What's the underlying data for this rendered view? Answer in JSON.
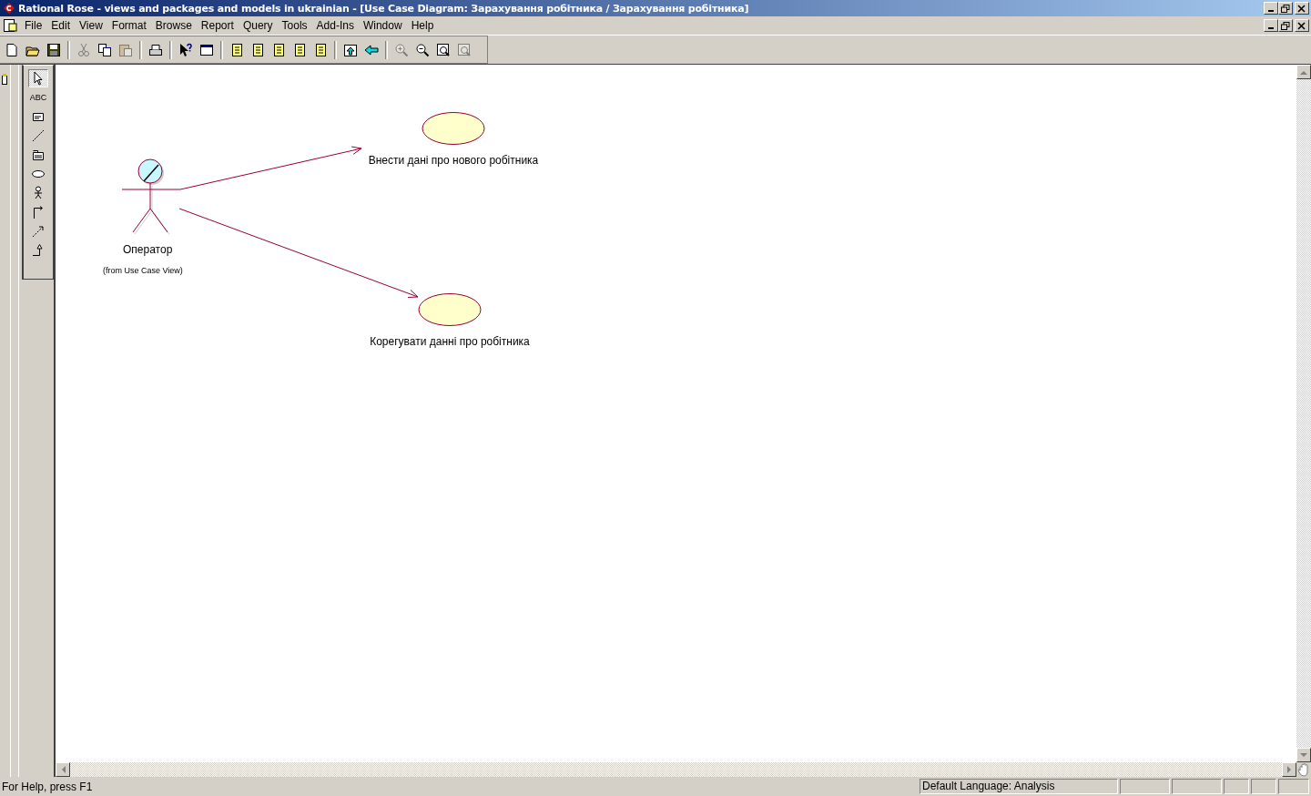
{
  "window": {
    "title": "Rational Rose - views and packages and models in ukrainian - [Use Case Diagram: Зарахування робітника / Зарахування робітника]"
  },
  "menu": [
    {
      "label": "File"
    },
    {
      "label": "Edit"
    },
    {
      "label": "View"
    },
    {
      "label": "Format"
    },
    {
      "label": "Browse"
    },
    {
      "label": "Report"
    },
    {
      "label": "Query"
    },
    {
      "label": "Tools"
    },
    {
      "label": "Add-Ins"
    },
    {
      "label": "Window"
    },
    {
      "label": "Help"
    }
  ],
  "toolbar": [
    {
      "kind": "new",
      "disabled": false
    },
    {
      "kind": "open",
      "disabled": false
    },
    {
      "kind": "save",
      "disabled": false
    },
    {
      "kind": "sep"
    },
    {
      "kind": "cut",
      "disabled": true
    },
    {
      "kind": "copy",
      "disabled": false
    },
    {
      "kind": "paste",
      "disabled": true
    },
    {
      "kind": "sep"
    },
    {
      "kind": "print",
      "disabled": false
    },
    {
      "kind": "sep"
    },
    {
      "kind": "helpcursor",
      "disabled": false
    },
    {
      "kind": "window",
      "disabled": false
    },
    {
      "kind": "sep"
    },
    {
      "kind": "doc",
      "disabled": false
    },
    {
      "kind": "doc",
      "disabled": false
    },
    {
      "kind": "doc",
      "disabled": false
    },
    {
      "kind": "doc",
      "disabled": false
    },
    {
      "kind": "doc",
      "disabled": false
    },
    {
      "kind": "sep"
    },
    {
      "kind": "up",
      "disabled": false
    },
    {
      "kind": "back",
      "disabled": false
    },
    {
      "kind": "sep"
    },
    {
      "kind": "zoomin",
      "disabled": true
    },
    {
      "kind": "zoomout",
      "disabled": false
    },
    {
      "kind": "fit",
      "disabled": false
    },
    {
      "kind": "fit",
      "disabled": true
    }
  ],
  "toolbox": [
    {
      "kind": "pointer",
      "selected": true
    },
    {
      "kind": "text",
      "label": "ABC",
      "selected": false
    },
    {
      "kind": "note",
      "selected": false
    },
    {
      "kind": "anchor",
      "selected": false
    },
    {
      "kind": "package",
      "selected": false
    },
    {
      "kind": "usecase",
      "selected": false
    },
    {
      "kind": "actor",
      "selected": false
    },
    {
      "kind": "association",
      "selected": false
    },
    {
      "kind": "dependency",
      "selected": false
    },
    {
      "kind": "generalization",
      "selected": false
    }
  ],
  "diagram": {
    "actor": {
      "name": "Оператор",
      "origin": "(from Use Case View)"
    },
    "use_cases": [
      {
        "name": "Внести дані про нового робітника"
      },
      {
        "name": "Корегувати данні про робітника"
      }
    ]
  },
  "status_bar": {
    "help": "For Help, press F1",
    "language": "Default Language: Analysis"
  }
}
